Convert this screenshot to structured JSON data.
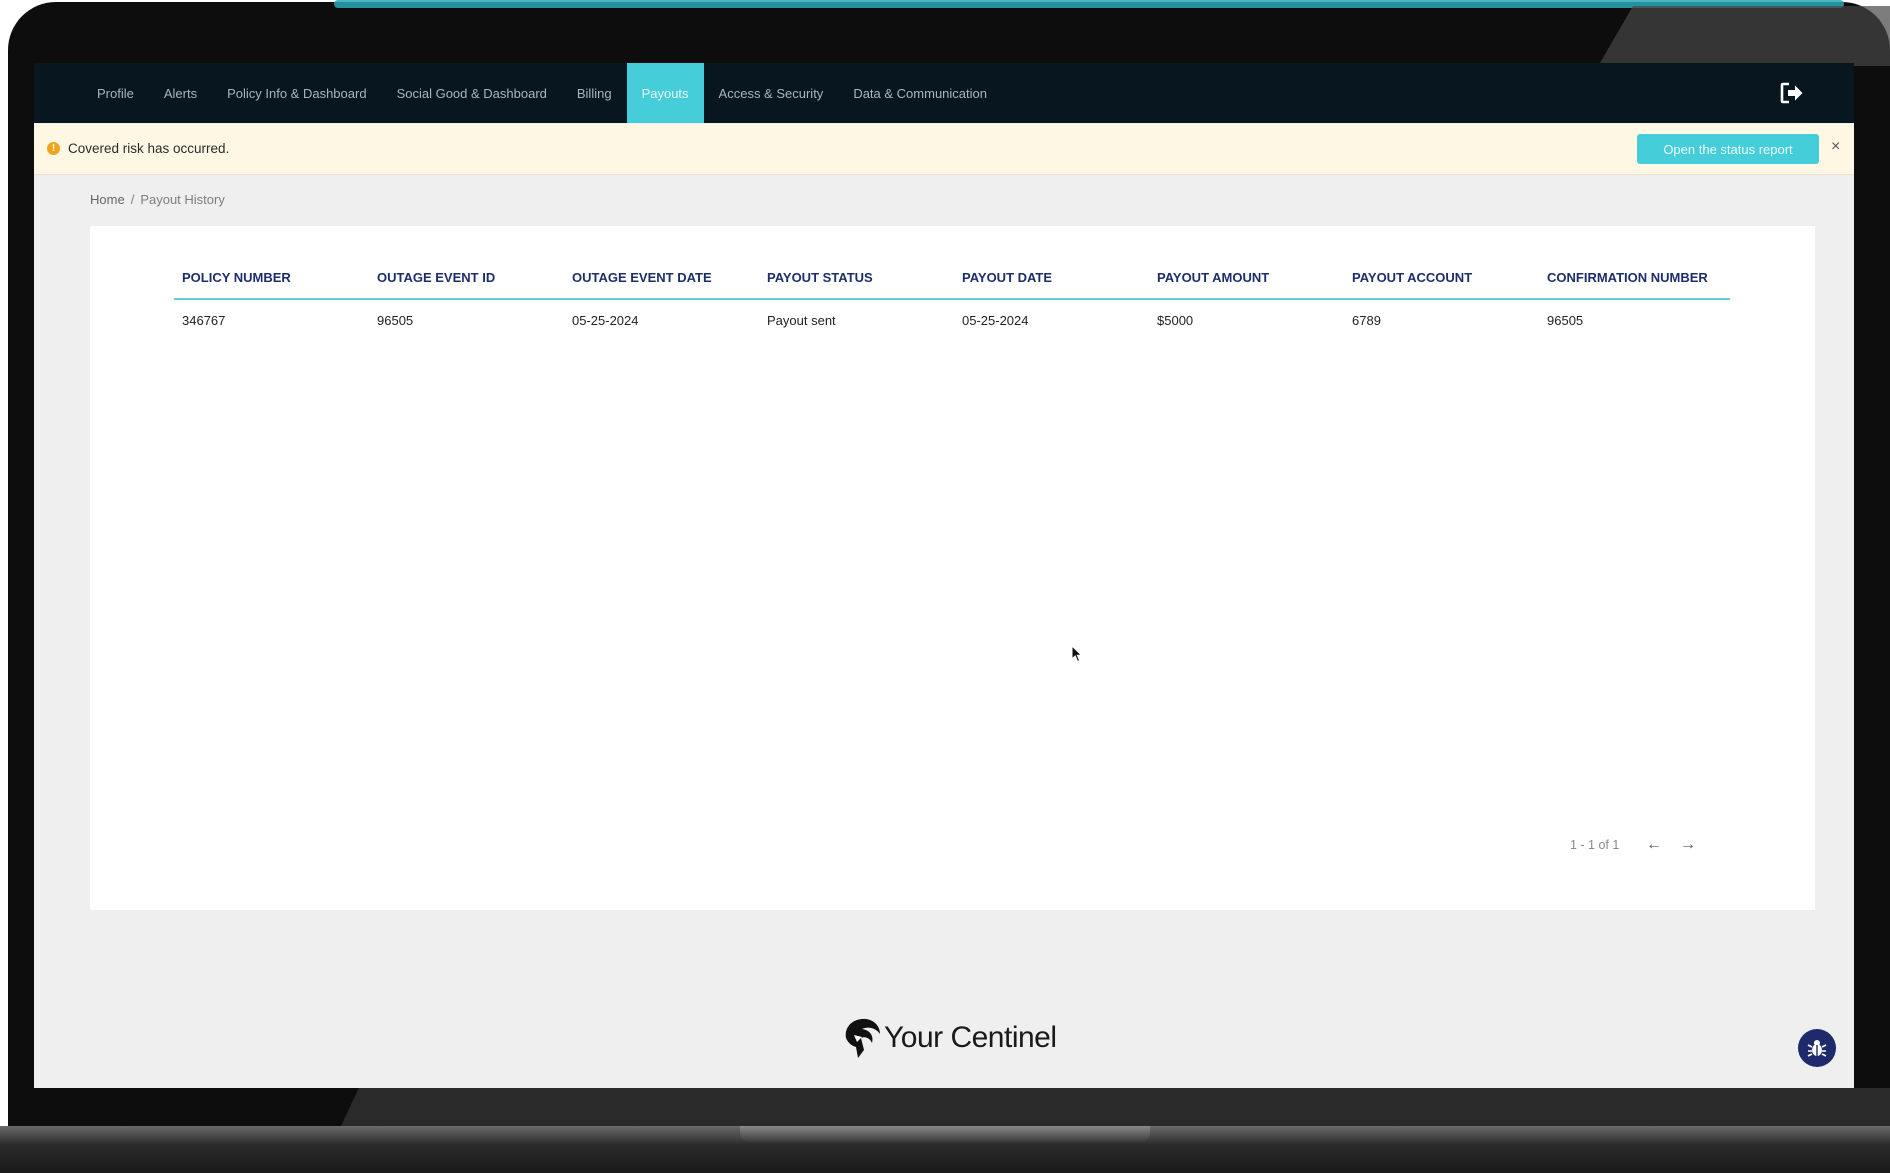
{
  "nav": {
    "items": [
      {
        "label": "Profile",
        "active": false
      },
      {
        "label": "Alerts",
        "active": false
      },
      {
        "label": "Policy Info & Dashboard",
        "active": false
      },
      {
        "label": "Social Good & Dashboard",
        "active": false
      },
      {
        "label": "Billing",
        "active": false
      },
      {
        "label": "Payouts",
        "active": true
      },
      {
        "label": "Access & Security",
        "active": false
      },
      {
        "label": "Data & Communication",
        "active": false
      }
    ],
    "logout_icon": "logout-icon"
  },
  "alert": {
    "text": "Covered risk has occurred.",
    "button_label": "Open the status report",
    "close_label": "×",
    "icon": "warning-icon"
  },
  "breadcrumb": {
    "home": "Home",
    "separator": "/",
    "current": "Payout History"
  },
  "table": {
    "columns": [
      "POLICY NUMBER",
      "OUTAGE EVENT ID",
      "OUTAGE EVENT DATE",
      "PAYOUT STATUS",
      "PAYOUT DATE",
      "PAYOUT AMOUNT",
      "PAYOUT ACCOUNT",
      "CONFIRMATION NUMBER"
    ],
    "rows": [
      [
        "346767",
        "96505",
        "05-25-2024",
        "Payout sent",
        "05-25-2024",
        "$5000",
        "6789",
        "96505"
      ]
    ]
  },
  "pagination": {
    "text": "1 - 1 of 1",
    "prev": "←",
    "next": "→"
  },
  "footer": {
    "brand": "Your Centinel"
  },
  "colors": {
    "nav_bg": "#07161f",
    "accent": "#45cdd9",
    "header_text": "#1e2d6b",
    "alert_bg": "#fdf7e3",
    "bug_button": "#1e2a6b"
  }
}
